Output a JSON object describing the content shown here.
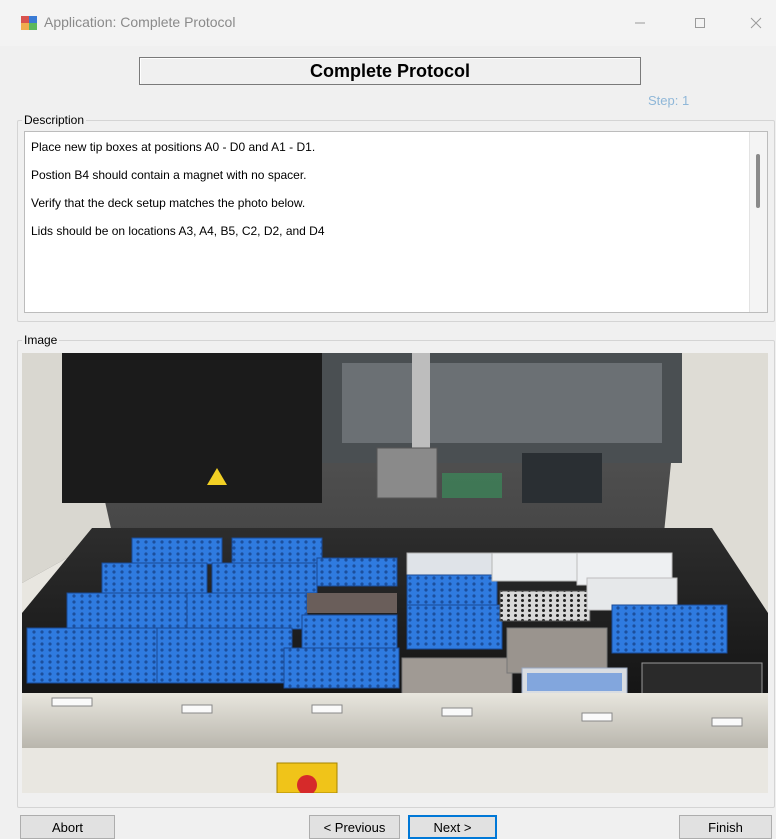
{
  "window": {
    "title": "Application: Complete Protocol",
    "minimize_icon": "minimize-icon",
    "maximize_icon": "maximize-icon",
    "close_icon": "close-icon"
  },
  "header": {
    "title": "Complete Protocol",
    "step": "Step: 1"
  },
  "description": {
    "label": "Description",
    "lines": [
      "Place new tip boxes at positions A0 - D0 and A1 - D1.",
      "Postion B4 should contain a magnet with no spacer.",
      "Verify that the deck setup matches the photo below.",
      "Lids should be on locations A3, A4, B5, C2, D2, and D4"
    ]
  },
  "image": {
    "label": "Image"
  },
  "buttons": {
    "abort": "Abort",
    "previous": "< Previous",
    "next": "Next >",
    "finish": "Finish"
  },
  "colors": {
    "tip_box_blue": "#2a6fd6",
    "step_text": "#8fb7d8",
    "focus_border": "#0078d7"
  }
}
